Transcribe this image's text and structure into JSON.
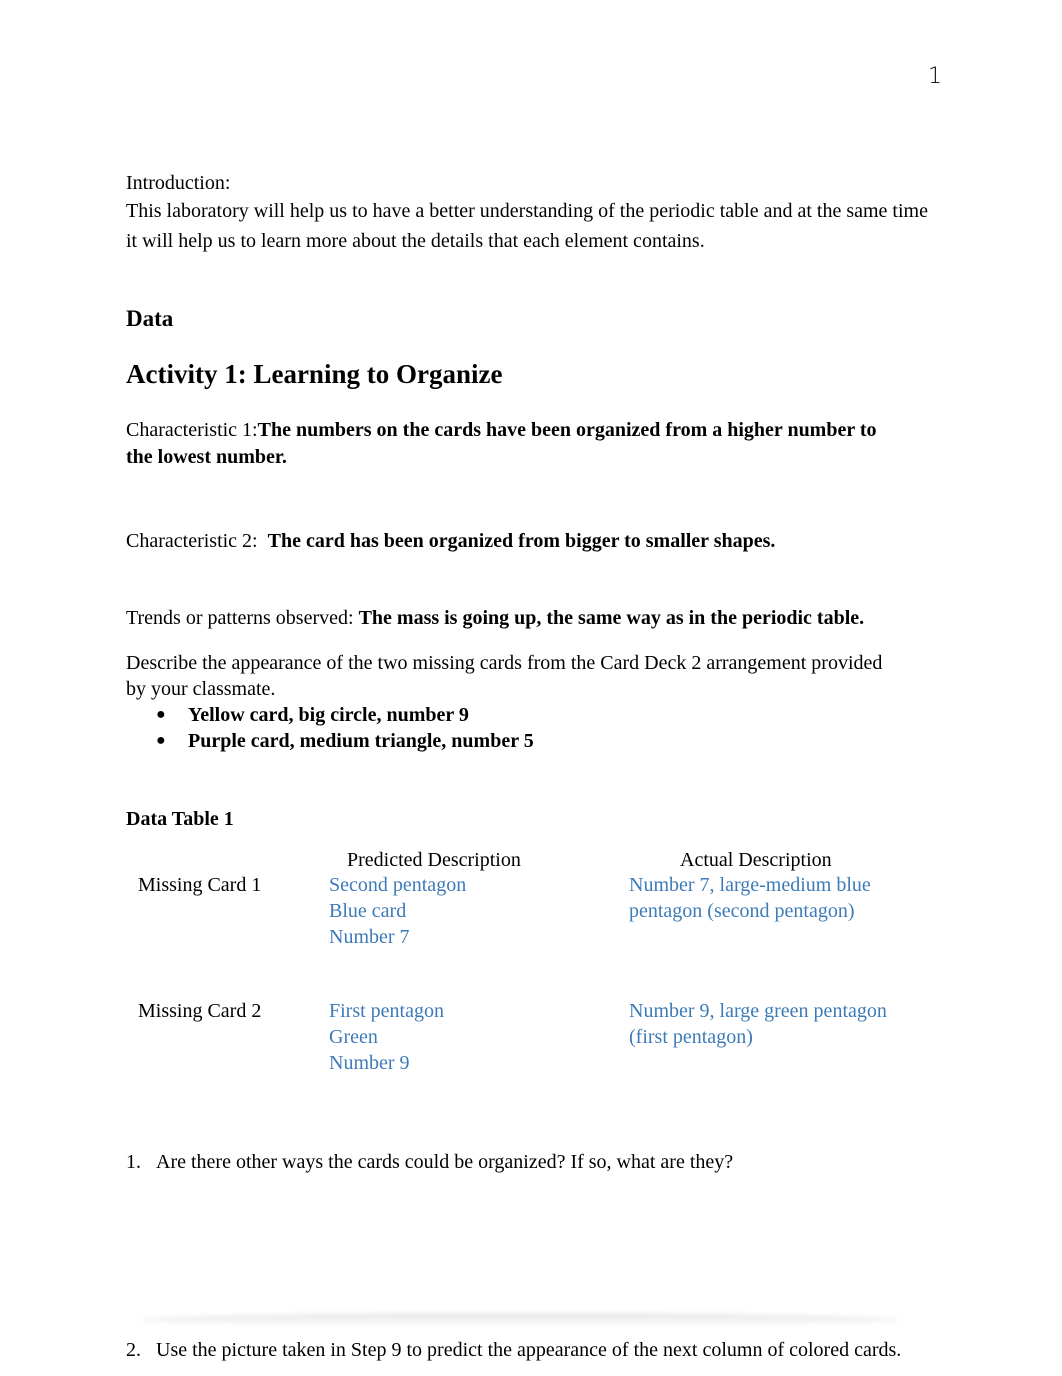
{
  "page": {
    "number": "1"
  },
  "introduction": {
    "label": "Introduction:",
    "text": "This laboratory will help us to have a better understanding of the periodic table and at the same time it will help us to learn more about the details that each element contains."
  },
  "sections": {
    "data_heading": "Data",
    "activity_heading": "Activity 1: Learning to Organize"
  },
  "characteristics": [
    {
      "label": "Characteristic 1:",
      "answer_line1": "The numbers on the cards have been organized from a higher number to",
      "answer_line2": "the lowest number."
    },
    {
      "label": "Characteristic 2:  ",
      "answer": "The card has been organized from bigger to smaller shapes."
    }
  ],
  "trends": {
    "label": "Trends or patterns observed: ",
    "answer": "The mass is going up, the same way as in the periodic table."
  },
  "describe": {
    "prompt_line1": "Describe the appearance of the two missing cards from the Card Deck 2 arrangement provided",
    "prompt_line2": "by your classmate.",
    "bullets": [
      "Yellow card, big circle, number 9",
      "Purple card, medium triangle, number 5"
    ]
  },
  "data_table": {
    "title": "Data Table 1",
    "headers": [
      "",
      "Predicted Description",
      "Actual Description"
    ],
    "rows": [
      {
        "label": "Missing Card 1",
        "predicted": [
          "Second pentagon",
          "Blue card",
          "Number 7"
        ],
        "actual": [
          "Number 7, large-medium blue",
          "pentagon (second pentagon)"
        ]
      },
      {
        "label": "Missing Card 2",
        "predicted": [
          "First pentagon",
          "Green",
          "Number 9"
        ],
        "actual": [
          "Number 9, large green pentagon",
          "(first pentagon)"
        ]
      }
    ]
  },
  "questions": [
    {
      "num": "1.",
      "text": "Are there other ways the cards could be organized? If so, what are they?"
    },
    {
      "num": "2.",
      "text": "Use the picture taken in Step 9 to predict the appearance of the next column of colored cards."
    }
  ],
  "colors": {
    "answer_blue": "#3d7ab8"
  }
}
